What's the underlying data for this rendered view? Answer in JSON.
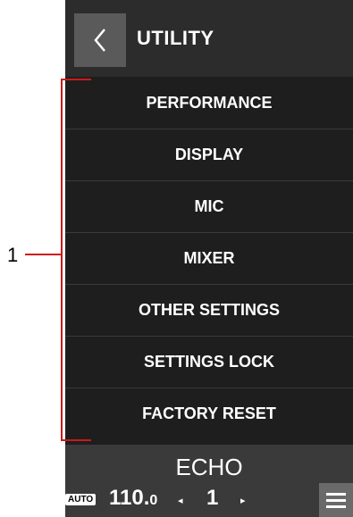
{
  "header": {
    "title": "UTILITY",
    "back_icon": "chevron-left-icon"
  },
  "menu": {
    "items": [
      {
        "label": "PERFORMANCE"
      },
      {
        "label": "DISPLAY"
      },
      {
        "label": "MIC"
      },
      {
        "label": "MIXER"
      },
      {
        "label": "OTHER SETTINGS"
      },
      {
        "label": "SETTINGS LOCK"
      },
      {
        "label": "FACTORY RESET"
      }
    ]
  },
  "footer": {
    "effect": "ECHO",
    "auto_badge": "AUTO",
    "bpm_int": "110.",
    "bpm_dec": "0",
    "beat": "1",
    "left_arrow": "◂",
    "right_arrow": "▸",
    "menu_icon": "hamburger-icon"
  },
  "callout": {
    "number": "1",
    "color": "#cc1a1a"
  },
  "colors": {
    "screen_bg": "#1e1e1e",
    "header_bg": "#2c2c2c",
    "footer_bg": "#3a3a3a",
    "text": "#ffffff"
  }
}
